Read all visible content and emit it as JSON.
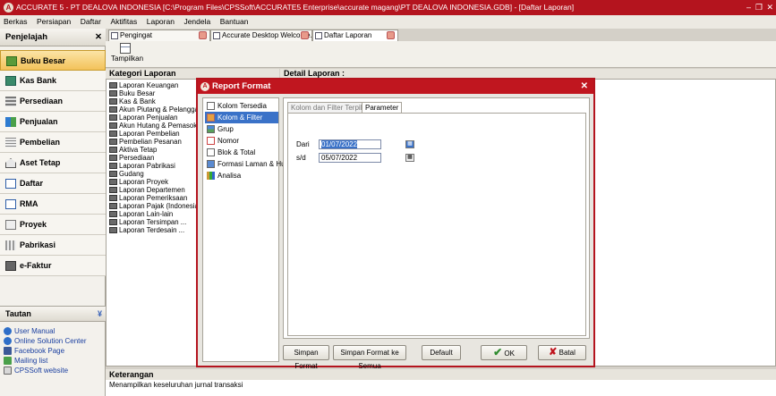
{
  "window": {
    "title": "ACCURATE 5 - PT DEALOVA INDONESIA  [C:\\Program Files\\CPSSoft\\ACCURATE5 Enterprise\\accurate magang\\PT DEALOVA INDONESIA.GDB] - [Daftar Laporan]"
  },
  "menu": [
    "Berkas",
    "Persiapan",
    "Daftar",
    "Aktifitas",
    "Laporan",
    "Jendela",
    "Bantuan"
  ],
  "sidebar": {
    "header": "Penjelajah",
    "items": [
      "Buku Besar",
      "Kas Bank",
      "Persediaan",
      "Penjualan",
      "Pembelian",
      "Aset Tetap",
      "Daftar",
      "RMA",
      "Proyek",
      "Pabrikasi",
      "e-Faktur"
    ],
    "active": "Buku Besar",
    "links_header": "Tautan",
    "links": [
      "User Manual",
      "Online Solution Center",
      "Facebook Page",
      "Mailing list",
      "CPSSoft website"
    ]
  },
  "tabs": [
    "Pengingat",
    "Accurate Desktop Welcome...",
    "Daftar Laporan"
  ],
  "toolbar": {
    "show_label": "Tampilkan"
  },
  "kategori": {
    "header": "Kategori Laporan",
    "items": [
      "Laporan Keuangan",
      "Buku Besar",
      "Kas & Bank",
      "Akun Piutang & Pelanggan",
      "Laporan Penjualan",
      "Akun Hutang & Pemasok",
      "Laporan Pembelian",
      "Pembelian Pesanan",
      "Aktiva Tetap",
      "Persediaan",
      "Laporan Pabrikasi",
      "Gudang",
      "Laporan Proyek",
      "Laporan Departemen",
      "Laporan Pemeriksaan",
      "Laporan Pajak (Indonesia)",
      "Laporan Lain-lain",
      "Laporan Tersimpan ...",
      "Laporan Terdesain ..."
    ]
  },
  "detail": {
    "header": "Detail Laporan :"
  },
  "keterangan": {
    "header": "Keterangan",
    "text": "Menampilkan keseluruhan jurnal transaksi"
  },
  "dialog": {
    "title": "Report Format",
    "nav": [
      "Kolom Tersedia",
      "Kolom & Filter",
      "Grup",
      "Nomor",
      "Blok & Total",
      "Formasi Laman & Huruf",
      "Analisa"
    ],
    "selected": "Kolom & Filter",
    "tabs": [
      "Kolom dan Filter Terpilih",
      "Parameter"
    ],
    "active_tab": "Parameter",
    "params": {
      "from_label": "Dari",
      "from_value": "01/07/2022",
      "to_label": "s/d",
      "to_value": "05/07/2022"
    },
    "buttons": {
      "save_format": "Simpan Format",
      "save_format_all": "Simpan Format ke Semua",
      "default": "Default",
      "ok": "OK",
      "cancel": "Batal"
    }
  }
}
